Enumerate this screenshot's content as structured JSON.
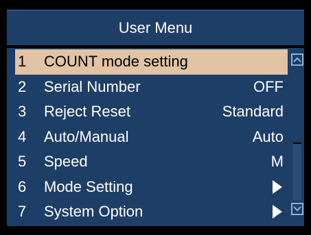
{
  "header": {
    "title": "User Menu"
  },
  "menu": {
    "items": [
      {
        "number": "1",
        "label": "COUNT mode setting",
        "value": "",
        "submenu": false,
        "selected": true
      },
      {
        "number": "2",
        "label": "Serial Number",
        "value": "OFF",
        "submenu": false,
        "selected": false
      },
      {
        "number": "3",
        "label": "Reject Reset",
        "value": "Standard",
        "submenu": false,
        "selected": false
      },
      {
        "number": "4",
        "label": "Auto/Manual",
        "value": "Auto",
        "submenu": false,
        "selected": false
      },
      {
        "number": "5",
        "label": "Speed",
        "value": "M",
        "submenu": false,
        "selected": false
      },
      {
        "number": "6",
        "label": "Mode Setting",
        "value": "",
        "submenu": true,
        "selected": false
      },
      {
        "number": "7",
        "label": "System Option",
        "value": "",
        "submenu": true,
        "selected": false
      }
    ]
  },
  "scrollbar": {
    "up_icon": "chevron-up-icon",
    "down_icon": "chevron-down-icon"
  },
  "colors": {
    "panel_bg": "#1d3e66",
    "selected_bg": "#e2c3a4",
    "text": "#ffffff",
    "background": "#000000"
  }
}
